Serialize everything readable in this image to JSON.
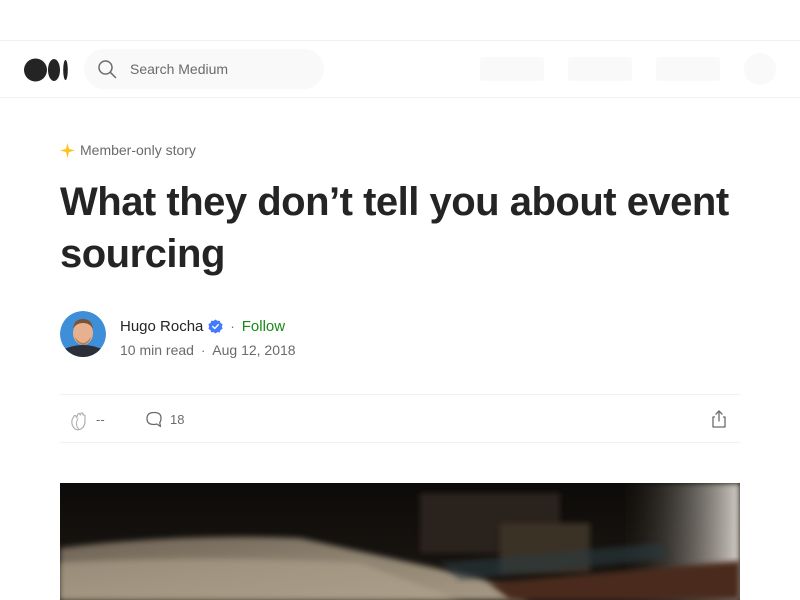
{
  "header": {
    "logo": "medium-logo-icon",
    "search": {
      "placeholder": "Search Medium",
      "value": ""
    }
  },
  "article": {
    "member_label": "Member-only story",
    "title": "What they don’t tell you about event sourcing",
    "author": {
      "name": "Hugo Rocha",
      "follow_label": "Follow",
      "separator": "·"
    },
    "meta": {
      "read_time": "10 min read",
      "separator": "·",
      "date": "Aug 12, 2018"
    },
    "actions": {
      "claps": "--",
      "responses": "18"
    }
  },
  "colors": {
    "accent_follow": "#1a8917",
    "member_star": "#ffc017",
    "badge": "#437aff",
    "muted_text": "#6b6b6b"
  }
}
